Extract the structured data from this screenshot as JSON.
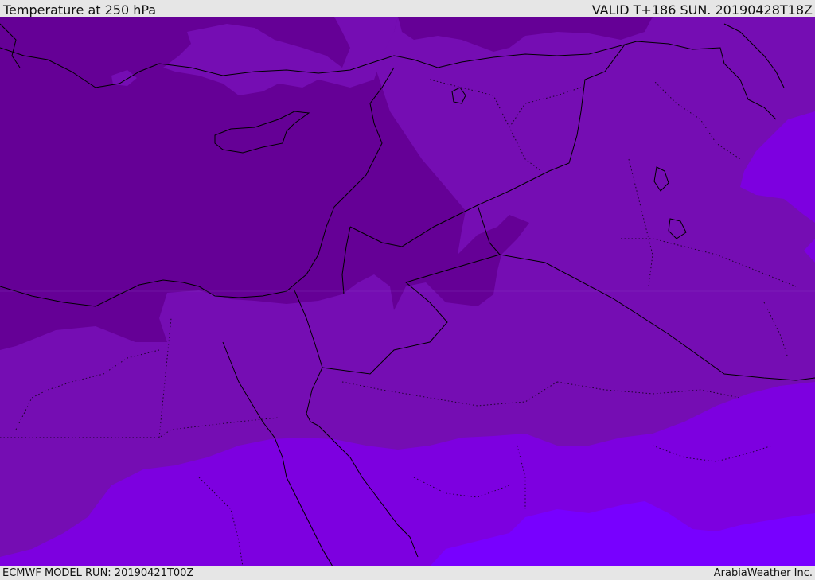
{
  "header": {
    "title": "Temperature at 250 hPa",
    "valid": "VALID T+186 SUN. 20190428T18Z"
  },
  "footer": {
    "model_run": "ECMWF MODEL RUN: 20190421T00Z",
    "credit": "ArabiaWeather Inc."
  },
  "colors": {
    "band_darkest": "#650096",
    "band_dark": "#6e07a8",
    "band_mid": "#750db3",
    "band_light": "#7d00e0",
    "band_lightest": "#7800ff",
    "border_line": "#000000",
    "header_background": "#e6e6e6"
  }
}
